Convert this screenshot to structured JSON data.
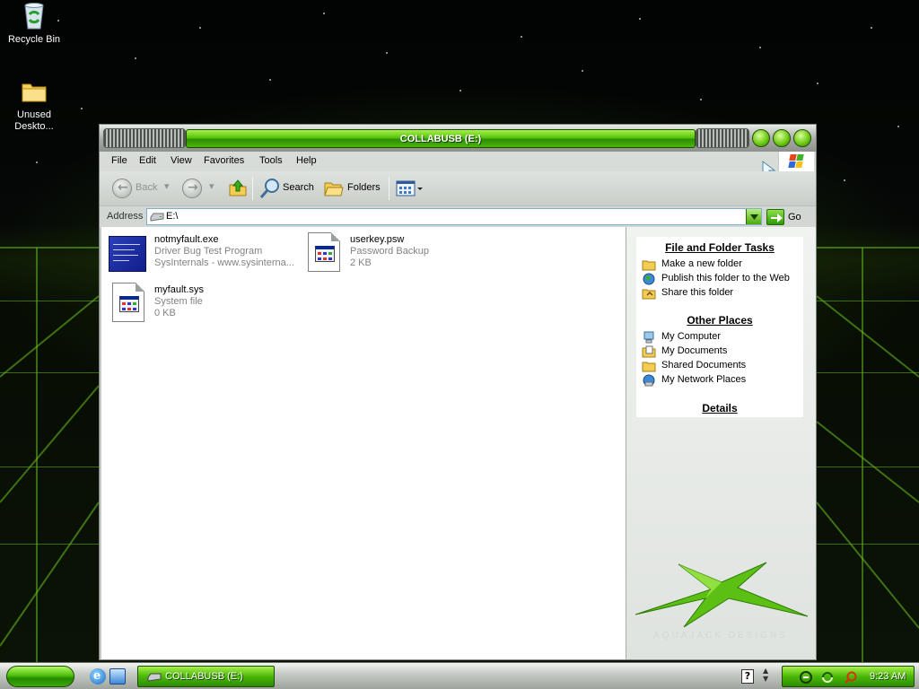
{
  "desktop": {
    "icons": [
      {
        "label": "Recycle Bin",
        "icon": "recycle-bin-icon"
      },
      {
        "label": "Unused Deskto...",
        "icon": "folder-icon"
      }
    ]
  },
  "window": {
    "title": "COLLABUSB (E:)",
    "menu": [
      "File",
      "Edit",
      "View",
      "Favorites",
      "Tools",
      "Help"
    ],
    "toolbar": {
      "back_label": "Back",
      "search_label": "Search",
      "folders_label": "Folders"
    },
    "address": {
      "label": "Address",
      "value": "E:\\",
      "go_label": "Go"
    },
    "files": [
      {
        "name": "notmyfault.exe",
        "description": "Driver Bug Test Program",
        "detail": "SysInternals - www.sysinterna..."
      },
      {
        "name": "userkey.psw",
        "description": "Password Backup",
        "detail": "2 KB"
      },
      {
        "name": "myfault.sys",
        "description": "System file",
        "detail": "0 KB"
      }
    ],
    "task_pane": {
      "file_folder_tasks": {
        "title": "File and Folder Tasks",
        "items": [
          "Make a new folder",
          "Publish this folder to the Web",
          "Share this folder"
        ]
      },
      "other_places": {
        "title": "Other Places",
        "items": [
          "My Computer",
          "My Documents",
          "Shared Documents",
          "My Network Places"
        ]
      },
      "details": {
        "title": "Details"
      },
      "brand_text": "AQUAJACK DESIGNS"
    }
  },
  "taskbar": {
    "active_task": "COLLABUSB (E:)",
    "clock": "9:23 AM"
  },
  "colors": {
    "accent_green": "#4ab808",
    "chrome_gray": "#c4c9c4"
  }
}
